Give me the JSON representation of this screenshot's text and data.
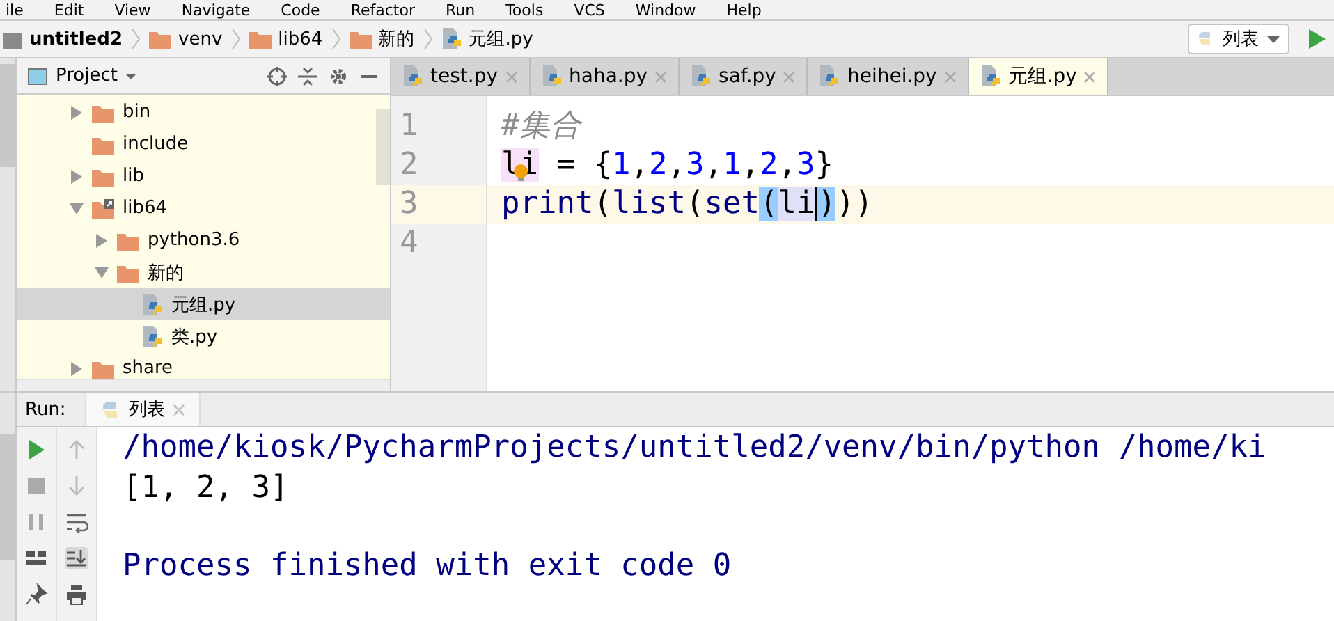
{
  "menu": [
    "ile",
    "Edit",
    "View",
    "Navigate",
    "Code",
    "Refactor",
    "Run",
    "Tools",
    "VCS",
    "Window",
    "Help"
  ],
  "breadcrumbs": [
    {
      "label": "untitled2",
      "kind": "project"
    },
    {
      "label": "venv",
      "kind": "folder"
    },
    {
      "label": "lib64",
      "kind": "folder"
    },
    {
      "label": "新的",
      "kind": "folder"
    },
    {
      "label": "元组.py",
      "kind": "python-file"
    }
  ],
  "run_config": {
    "label": "列表"
  },
  "project_panel": {
    "title": "Project",
    "tree": [
      {
        "label": "bin",
        "kind": "folder",
        "expanded": false,
        "selected": false
      },
      {
        "label": "include",
        "kind": "folder",
        "selected": false
      },
      {
        "label": "lib",
        "kind": "folder",
        "expanded": false,
        "selected": false
      },
      {
        "label": "lib64",
        "kind": "folder-link",
        "expanded": true,
        "selected": false,
        "children": [
          {
            "label": "python3.6",
            "kind": "folder",
            "expanded": false,
            "selected": false
          },
          {
            "label": "新的",
            "kind": "folder",
            "expanded": true,
            "selected": false,
            "children": [
              {
                "label": "元组.py",
                "kind": "python-file",
                "selected": true
              },
              {
                "label": "类.py",
                "kind": "python-file",
                "selected": false
              }
            ]
          }
        ]
      },
      {
        "label": "share",
        "kind": "folder",
        "expanded": false,
        "selected": false
      }
    ]
  },
  "editor": {
    "tabs": [
      {
        "label": "test.py",
        "selected": false
      },
      {
        "label": "haha.py",
        "selected": false
      },
      {
        "label": "saf.py",
        "selected": false
      },
      {
        "label": "heihei.py",
        "selected": false
      },
      {
        "label": "元组.py",
        "selected": true
      }
    ],
    "line_numbers": [
      "1",
      "2",
      "3",
      "4"
    ],
    "lines": [
      {
        "current": false,
        "tokens": [
          {
            "text": "#集合",
            "kind": "comment"
          }
        ]
      },
      {
        "current": false,
        "tokens": [
          {
            "text": "li",
            "kind": "write-usage"
          },
          {
            "text": " = {",
            "kind": "plain"
          },
          {
            "text": "1",
            "kind": "number"
          },
          {
            "text": ",",
            "kind": "plain"
          },
          {
            "text": "2",
            "kind": "number"
          },
          {
            "text": ",",
            "kind": "plain"
          },
          {
            "text": "3",
            "kind": "number"
          },
          {
            "text": ",",
            "kind": "plain"
          },
          {
            "text": "1",
            "kind": "number"
          },
          {
            "text": ",",
            "kind": "plain"
          },
          {
            "text": "2",
            "kind": "number"
          },
          {
            "text": ",",
            "kind": "plain"
          },
          {
            "text": "3",
            "kind": "number"
          },
          {
            "text": "}",
            "kind": "plain"
          }
        ]
      },
      {
        "current": true,
        "tokens": [
          {
            "text": "print",
            "kind": "builtin"
          },
          {
            "text": "(",
            "kind": "plain"
          },
          {
            "text": "list",
            "kind": "builtin"
          },
          {
            "text": "(",
            "kind": "plain"
          },
          {
            "text": "set",
            "kind": "builtin"
          },
          {
            "text": "(",
            "kind": "brace-match"
          },
          {
            "text": "li",
            "kind": "read-usage"
          },
          {
            "text": ")",
            "kind": "brace-match"
          },
          {
            "text": "))",
            "kind": "plain"
          }
        ]
      }
    ]
  },
  "run_panel": {
    "label": "Run:",
    "tab": {
      "label": "列表"
    },
    "console": [
      {
        "text": "/home/kiosk/PycharmProjects/untitled2/venv/bin/python /home/ki",
        "kind": "system"
      },
      {
        "text": "[1, 2, 3]",
        "kind": "output"
      },
      {
        "text": "Process finished with exit code 0",
        "kind": "system"
      }
    ]
  }
}
